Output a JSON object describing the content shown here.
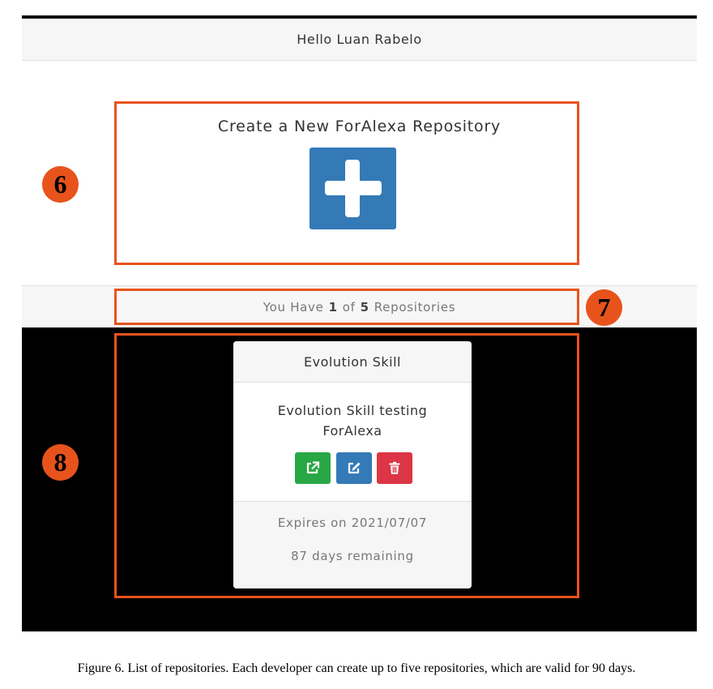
{
  "header": {
    "greeting": "Hello Luan Rabelo"
  },
  "create_section": {
    "title": "Create a New ForAlexa Repository",
    "button_icon": "plus-icon"
  },
  "repo_count": {
    "prefix": "You Have",
    "current": "1",
    "of_word": "of",
    "max": "5",
    "suffix": "Repositories"
  },
  "repositories": [
    {
      "name": "Evolution Skill",
      "description_line1": "Evolution Skill testing",
      "description_line2": "ForAlexa",
      "actions": [
        {
          "icon": "external-link-icon",
          "color": "#28a745"
        },
        {
          "icon": "edit-icon",
          "color": "#337ab7"
        },
        {
          "icon": "trash-icon",
          "color": "#dc3545"
        }
      ],
      "expires": "Expires on 2021/07/07",
      "remaining": "87 days remaining"
    }
  ],
  "annotations": {
    "label_6": "6",
    "label_7": "7",
    "label_8": "8",
    "color": "#e8531c"
  },
  "caption": "Figure 6. List of repositories. Each developer can create up to five repositories, which are valid for 90 days."
}
